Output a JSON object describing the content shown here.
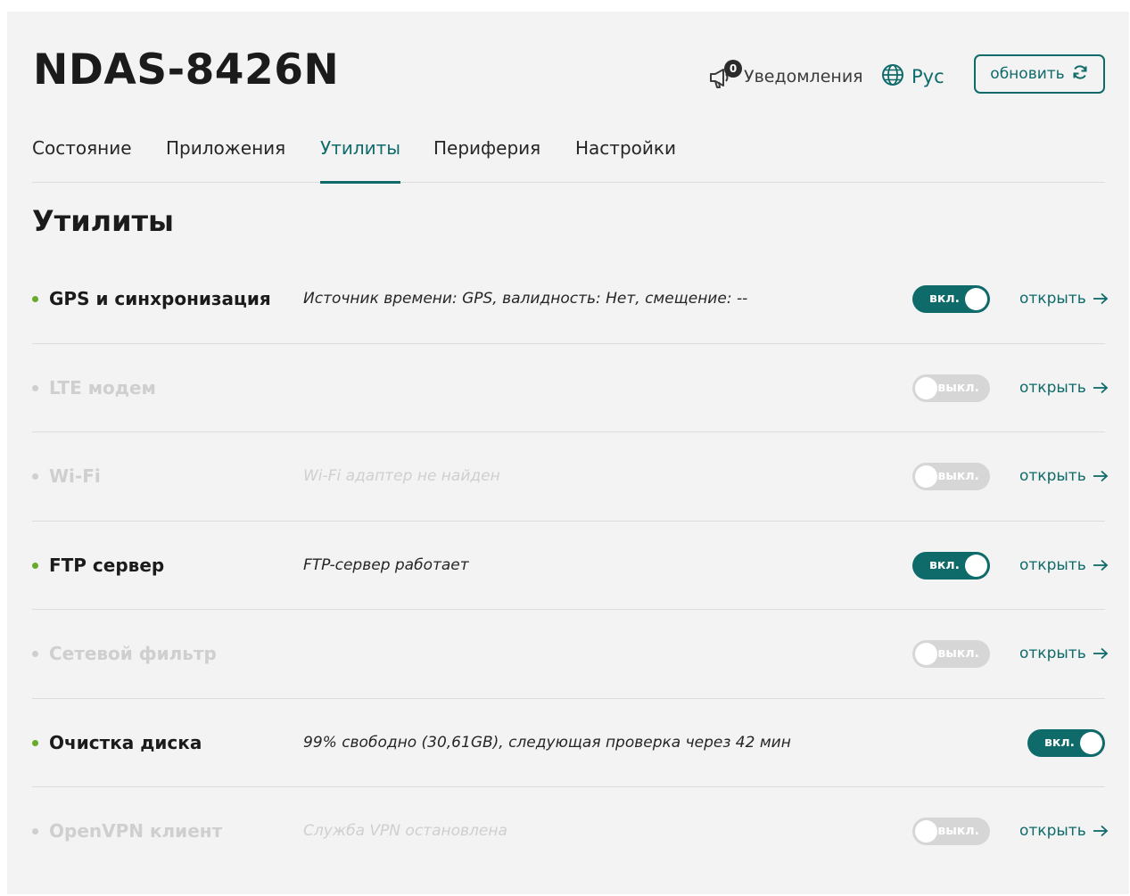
{
  "header": {
    "device_title": "NDAS-8426N",
    "notifications": {
      "count": "0",
      "label": "Уведомления",
      "icon": "megaphone-icon"
    },
    "language": {
      "label": "Рус",
      "icon": "globe-icon"
    },
    "refresh": {
      "label": "обновить",
      "icon": "refresh-icon"
    }
  },
  "tabs": [
    {
      "label": "Состояние",
      "active": false
    },
    {
      "label": "Приложения",
      "active": false
    },
    {
      "label": "Утилиты",
      "active": true
    },
    {
      "label": "Периферия",
      "active": false
    },
    {
      "label": "Настройки",
      "active": false
    }
  ],
  "section_title": "Утилиты",
  "utilities": [
    {
      "name": "GPS и синхронизация",
      "description": "Источник времени: GPS, валидность: Нет, смещение: --",
      "status": "вкл.",
      "enabled": true,
      "has_open_link": true
    },
    {
      "name": "LTE модем",
      "description": "",
      "status": "выкл.",
      "enabled": false,
      "has_open_link": true
    },
    {
      "name": "Wi-Fi",
      "description": "Wi-Fi адаптер не найден",
      "status": "выкл.",
      "enabled": false,
      "has_open_link": true
    },
    {
      "name": "FTP сервер",
      "description": "FTP-сервер работает",
      "status": "вкл.",
      "enabled": true,
      "has_open_link": true
    },
    {
      "name": "Сетевой фильтр",
      "description": "",
      "status": "выкл.",
      "enabled": false,
      "has_open_link": true
    },
    {
      "name": "Очистка диска",
      "description": "99% свободно (30,61GB), следующая проверка через 42 мин",
      "status": "вкл.",
      "enabled": true,
      "has_open_link": false
    },
    {
      "name": "OpenVPN клиент",
      "description": "Служба VPN остановлена",
      "status": "выкл.",
      "enabled": false,
      "has_open_link": true
    }
  ],
  "open_link_label": "открыть",
  "colors": {
    "accent": "#0f6a6a",
    "status_dot_on": "#6aaa2a",
    "status_dot_off": "#cfcfcf",
    "toggle_off": "#d6d6d6"
  }
}
